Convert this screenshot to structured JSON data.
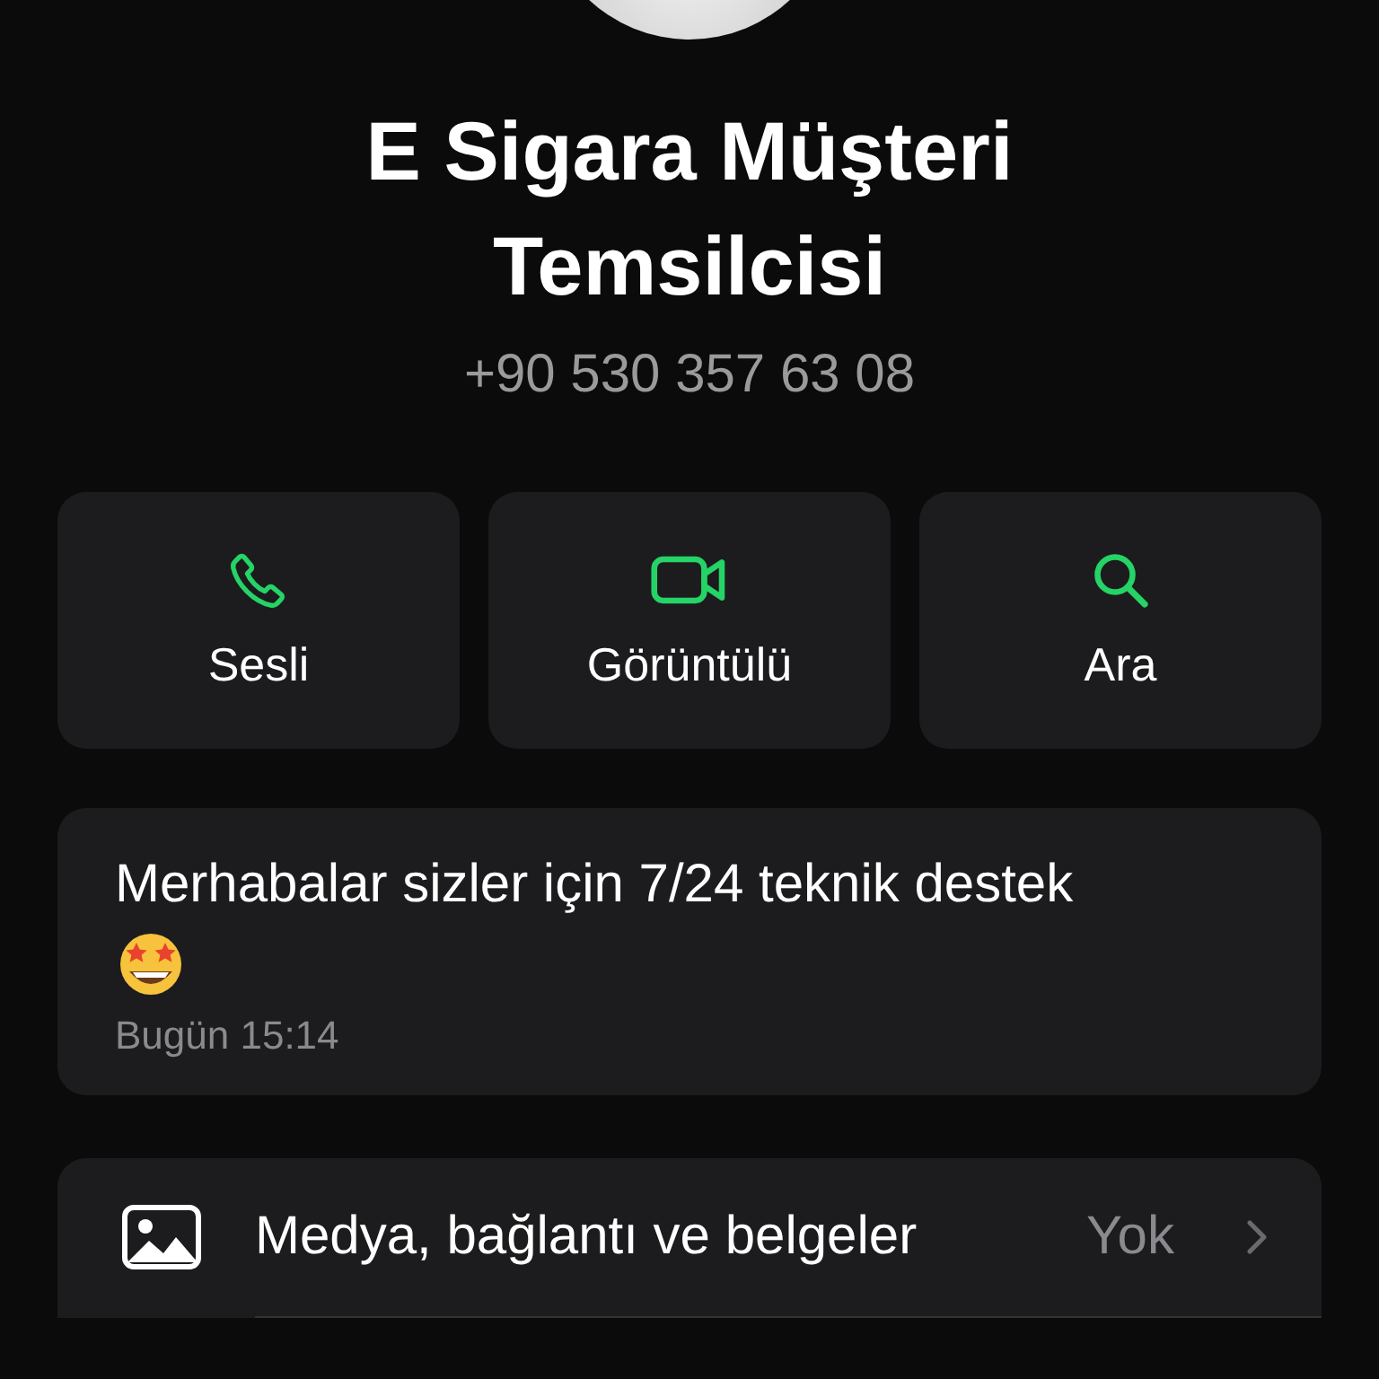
{
  "contact": {
    "name": "E Sigara Müşteri Temsilcisi",
    "phone": "+90 530 357 63 08"
  },
  "actions": [
    {
      "kind": "phone",
      "label": "Sesli"
    },
    {
      "kind": "video",
      "label": "Görüntülü"
    },
    {
      "kind": "search",
      "label": "Ara"
    }
  ],
  "about": {
    "text": "Merhabalar sizler için 7/24 teknik destek",
    "date": "Bugün 15:14"
  },
  "rows": [
    {
      "kind": "media",
      "label": "Medya, bağlantı ve belgeler",
      "value": "Yok"
    }
  ]
}
